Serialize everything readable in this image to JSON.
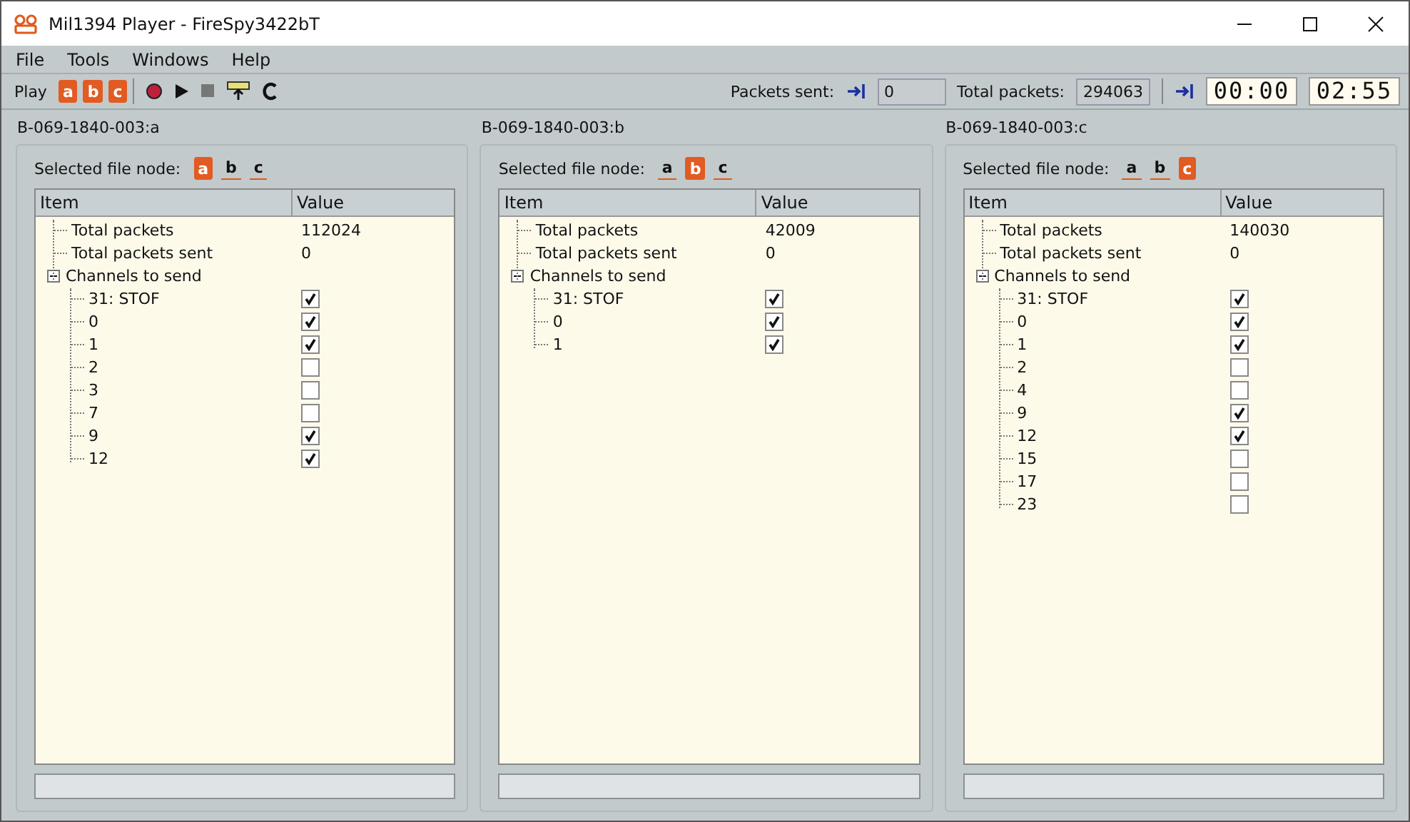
{
  "window": {
    "title": "Mil1394 Player - FireSpy3422bT"
  },
  "menu": [
    "File",
    "Tools",
    "Windows",
    "Help"
  ],
  "toolbar": {
    "play_label": "Play",
    "play_nodes": [
      "a",
      "b",
      "c"
    ],
    "packets_sent_label": "Packets sent:",
    "packets_sent": "0",
    "total_packets_label": "Total packets:",
    "total_packets": "294063",
    "timers": [
      "00:00",
      "02:55"
    ]
  },
  "panels": [
    {
      "title": "B-069-1840-003:a",
      "node_label": "Selected file node:",
      "nodes": [
        {
          "label": "a",
          "selected": true
        },
        {
          "label": "b",
          "selected": false
        },
        {
          "label": "c",
          "selected": false
        }
      ],
      "columns": [
        "Item",
        "Value"
      ],
      "rows": [
        {
          "label": "Total packets",
          "value": "112024"
        },
        {
          "label": "Total packets sent",
          "value": "0"
        }
      ],
      "group": {
        "label": "Channels to send",
        "expanded": true,
        "children": [
          {
            "label": "31: STOF",
            "checked": true
          },
          {
            "label": "0",
            "checked": true
          },
          {
            "label": "1",
            "checked": true
          },
          {
            "label": "2",
            "checked": false
          },
          {
            "label": "3",
            "checked": false
          },
          {
            "label": "7",
            "checked": false
          },
          {
            "label": "9",
            "checked": true
          },
          {
            "label": "12",
            "checked": true
          }
        ]
      }
    },
    {
      "title": "B-069-1840-003:b",
      "node_label": "Selected file node:",
      "nodes": [
        {
          "label": "a",
          "selected": false
        },
        {
          "label": "b",
          "selected": true
        },
        {
          "label": "c",
          "selected": false
        }
      ],
      "columns": [
        "Item",
        "Value"
      ],
      "rows": [
        {
          "label": "Total packets",
          "value": "42009"
        },
        {
          "label": "Total packets sent",
          "value": "0"
        }
      ],
      "group": {
        "label": "Channels to send",
        "expanded": true,
        "children": [
          {
            "label": "31: STOF",
            "checked": true
          },
          {
            "label": "0",
            "checked": true
          },
          {
            "label": "1",
            "checked": true
          }
        ]
      }
    },
    {
      "title": "B-069-1840-003:c",
      "node_label": "Selected file node:",
      "nodes": [
        {
          "label": "a",
          "selected": false
        },
        {
          "label": "b",
          "selected": false
        },
        {
          "label": "c",
          "selected": true
        }
      ],
      "columns": [
        "Item",
        "Value"
      ],
      "rows": [
        {
          "label": "Total packets",
          "value": "140030"
        },
        {
          "label": "Total packets sent",
          "value": "0"
        }
      ],
      "group": {
        "label": "Channels to send",
        "expanded": true,
        "children": [
          {
            "label": "31: STOF",
            "checked": true
          },
          {
            "label": "0",
            "checked": true
          },
          {
            "label": "1",
            "checked": true
          },
          {
            "label": "2",
            "checked": false
          },
          {
            "label": "4",
            "checked": false
          },
          {
            "label": "9",
            "checked": true
          },
          {
            "label": "12",
            "checked": true
          },
          {
            "label": "15",
            "checked": false
          },
          {
            "label": "17",
            "checked": false
          },
          {
            "label": "23",
            "checked": false
          }
        ]
      }
    }
  ]
}
